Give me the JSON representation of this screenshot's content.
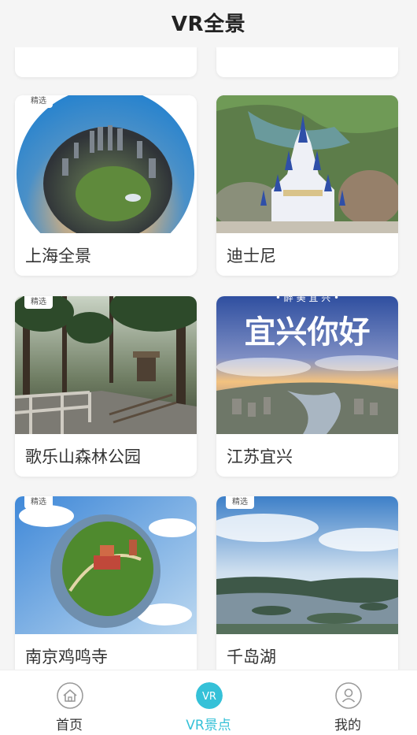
{
  "header": {
    "title": "VR全景"
  },
  "badge_text": "精选",
  "cards": [
    {
      "label": "上海全景",
      "featured": true
    },
    {
      "label": "迪士尼",
      "featured": false
    },
    {
      "label": "歌乐山森林公园",
      "featured": true
    },
    {
      "label": "江苏宜兴",
      "featured": false
    },
    {
      "label": "南京鸡鸣寺",
      "featured": true
    },
    {
      "label": "千岛湖",
      "featured": true
    }
  ],
  "yixing_overlay": {
    "small": "• 醉 美 宜 兴 •",
    "big": "宜兴你好"
  },
  "tabbar": {
    "items": [
      {
        "label": "首页",
        "icon": "home-icon",
        "active": false
      },
      {
        "label": "VR景点",
        "icon": "vr-icon",
        "active": true
      },
      {
        "label": "我的",
        "icon": "profile-icon",
        "active": false
      }
    ]
  },
  "colors": {
    "accent": "#35c1d8",
    "background": "#f5f5f5",
    "text": "#333333"
  }
}
